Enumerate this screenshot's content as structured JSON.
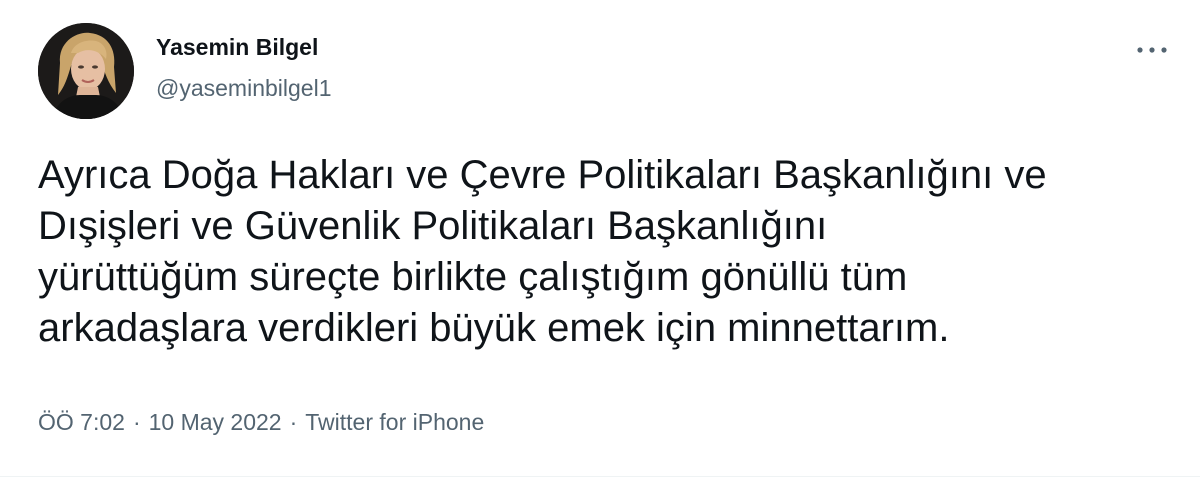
{
  "author": {
    "display_name": "Yasemin Bilgel",
    "handle": "@yaseminbilgel1"
  },
  "tweet": {
    "lines": [
      "Ayrıca Doğa Hakları ve Çevre Politikaları Başkanlığını ve",
      "Dışişleri ve Güvenlik Politikaları Başkanlığını",
      "yürüttüğüm süreçte birlikte çalıştığım gönüllü tüm",
      "arkadaşlara verdikleri büyük emek için minnettarım."
    ]
  },
  "meta": {
    "time": "ÖÖ 7:02",
    "separator": "·",
    "date": "10 May 2022",
    "source": "Twitter for iPhone"
  },
  "icons": {
    "more": "more-horizontal-icon",
    "avatar": "profile-photo"
  },
  "colors": {
    "text_primary": "#0f1419",
    "text_secondary": "#536471",
    "background": "#ffffff"
  }
}
